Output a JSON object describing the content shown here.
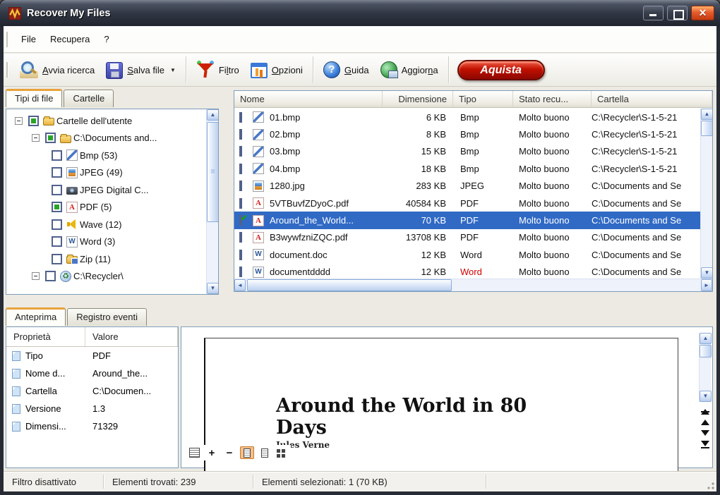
{
  "window": {
    "title": "Recover My Files"
  },
  "colors": {
    "accent_orange": "#e8a33c",
    "selection_blue": "#316ac5",
    "buy_red": "#c01000",
    "error_red": "#d40000",
    "titlebar": "#2f3542"
  },
  "menu": {
    "items": [
      "File",
      "Recupera",
      "?"
    ]
  },
  "toolbar": {
    "buttons": [
      {
        "icon": "search-icon",
        "pre": "",
        "accel": "A",
        "post": "vvia ricerca"
      },
      {
        "icon": "save-icon",
        "pre": "",
        "accel": "S",
        "post": "alva file"
      },
      {
        "icon": "filter-icon",
        "pre": "Fi",
        "accel": "l",
        "post": "tro"
      },
      {
        "icon": "options-icon",
        "pre": "",
        "accel": "O",
        "post": "pzioni"
      },
      {
        "icon": "help-icon",
        "pre": "",
        "accel": "G",
        "post": "uida"
      },
      {
        "icon": "update-icon",
        "pre": "Aggior",
        "accel": "n",
        "post": "a"
      }
    ],
    "buy_label": "Aquista"
  },
  "left_tabs": {
    "items": [
      {
        "label": "Tipi di file"
      },
      {
        "label": "Cartelle"
      }
    ]
  },
  "tree": {
    "items": [
      {
        "label": "Cartelle dell'utente",
        "icon": "user-folder",
        "checked": "on",
        "expand": true,
        "level": 0
      },
      {
        "label": "C:\\Documents and...",
        "icon": "folder",
        "checked": "on",
        "expand": true,
        "level": 1
      },
      {
        "label": "Bmp (53)",
        "icon": "bmp",
        "checked": "off",
        "expand": false,
        "level": 2
      },
      {
        "label": "JPEG (49)",
        "icon": "jpeg",
        "checked": "off",
        "expand": false,
        "level": 2
      },
      {
        "label": "JPEG Digital C...",
        "icon": "camera",
        "checked": "off",
        "expand": false,
        "level": 2
      },
      {
        "label": "PDF (5)",
        "icon": "pdf",
        "checked": "on",
        "expand": false,
        "level": 2
      },
      {
        "label": "Wave (12)",
        "icon": "wave",
        "checked": "off",
        "expand": false,
        "level": 2
      },
      {
        "label": "Word (3)",
        "icon": "word",
        "checked": "off",
        "expand": false,
        "level": 2
      },
      {
        "label": "Zip (11)",
        "icon": "zip",
        "checked": "off",
        "expand": false,
        "level": 2
      },
      {
        "label": "C:\\Recycler\\",
        "icon": "recycler",
        "checked": "off",
        "expand": true,
        "level": 1
      }
    ]
  },
  "filelist": {
    "headers": [
      "Nome",
      "Dimensione",
      "Tipo",
      "Stato recu...",
      "Cartella"
    ],
    "rows": [
      {
        "name": "01.bmp",
        "size": "6 KB",
        "type": "Bmp",
        "status": "Molto buono",
        "folder": "C:\\Recycler\\S-1-5-21",
        "icon": "bmp",
        "checked": false,
        "selected": false
      },
      {
        "name": "02.bmp",
        "size": "8 KB",
        "type": "Bmp",
        "status": "Molto buono",
        "folder": "C:\\Recycler\\S-1-5-21",
        "icon": "bmp",
        "checked": false,
        "selected": false
      },
      {
        "name": "03.bmp",
        "size": "15 KB",
        "type": "Bmp",
        "status": "Molto buono",
        "folder": "C:\\Recycler\\S-1-5-21",
        "icon": "bmp",
        "checked": false,
        "selected": false
      },
      {
        "name": "04.bmp",
        "size": "18 KB",
        "type": "Bmp",
        "status": "Molto buono",
        "folder": "C:\\Recycler\\S-1-5-21",
        "icon": "bmp",
        "checked": false,
        "selected": false
      },
      {
        "name": "1280.jpg",
        "size": "283 KB",
        "type": "JPEG",
        "status": "Molto buono",
        "folder": "C:\\Documents and Se",
        "icon": "jpeg",
        "checked": false,
        "selected": false
      },
      {
        "name": "5VTBuvfZDyoC.pdf",
        "size": "40584 KB",
        "type": "PDF",
        "status": "Molto buono",
        "folder": "C:\\Documents and Se",
        "icon": "pdf",
        "checked": false,
        "selected": false
      },
      {
        "name": "Around_the_World...",
        "size": "70 KB",
        "type": "PDF",
        "status": "Molto buono",
        "folder": "C:\\Documents and Se",
        "icon": "pdf",
        "checked": true,
        "selected": true
      },
      {
        "name": "B3wywfzniZQC.pdf",
        "size": "13708 KB",
        "type": "PDF",
        "status": "Molto buono",
        "folder": "C:\\Documents and Se",
        "icon": "pdf",
        "checked": false,
        "selected": false
      },
      {
        "name": "document.doc",
        "size": "12 KB",
        "type": "Word",
        "status": "Molto buono",
        "folder": "C:\\Documents and Se",
        "icon": "word",
        "checked": false,
        "selected": false
      },
      {
        "name": "documentdddd",
        "size": "12 KB",
        "type": "Word",
        "status": "Molto buono",
        "folder": "C:\\Documents and Se",
        "icon": "word",
        "checked": false,
        "selected": false,
        "type_red": true
      }
    ]
  },
  "bottom_tabs": {
    "items": [
      {
        "label": "Anteprima"
      },
      {
        "label": "Registro eventi"
      }
    ]
  },
  "properties": {
    "headers": [
      "Proprietà",
      "Valore"
    ],
    "rows": [
      {
        "key": "Tipo",
        "value": "PDF"
      },
      {
        "key": "Nome d...",
        "value": "Around_the..."
      },
      {
        "key": "Cartella",
        "value": "C:\\Documen..."
      },
      {
        "key": "Versione",
        "value": "1.3"
      },
      {
        "key": "Dimensi...",
        "value": "71329"
      }
    ]
  },
  "preview": {
    "title_line1": "Around the World in 80",
    "title_line2": "Days",
    "author": "Jules Verne",
    "toolbar_icons": [
      "text-view-icon",
      "zoom-in-icon",
      "zoom-out-icon",
      "one-page-icon",
      "two-page-icon",
      "thumbnails-icon"
    ],
    "nav_icons": [
      "first-page-icon",
      "previous-page-icon",
      "next-page-icon",
      "last-page-icon"
    ]
  },
  "statusbar": {
    "filter": "Filtro disattivato",
    "found": "Elementi trovati: 239",
    "selected": "Elementi selezionati: 1 (70 KB)"
  }
}
